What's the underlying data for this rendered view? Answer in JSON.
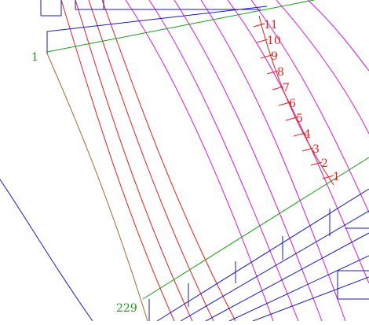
{
  "colors": {
    "background": "#ffffff",
    "blue_lines": "#1a1ab8",
    "red_arcs": "#e11f1f",
    "magenta_arcs": "#d21bd2",
    "green_lines": "#1b9a1b",
    "brown_arc": "#a76b2b",
    "label_red": "#e11f1f",
    "label_green": "#1b9a1b"
  },
  "labels": {
    "line_marker_top": "1",
    "line_marker_bottom": "229"
  },
  "scale_labels": [
    "1",
    "2",
    "3",
    "4",
    "5",
    "6",
    "7",
    "8",
    "9",
    "10",
    "11"
  ]
}
